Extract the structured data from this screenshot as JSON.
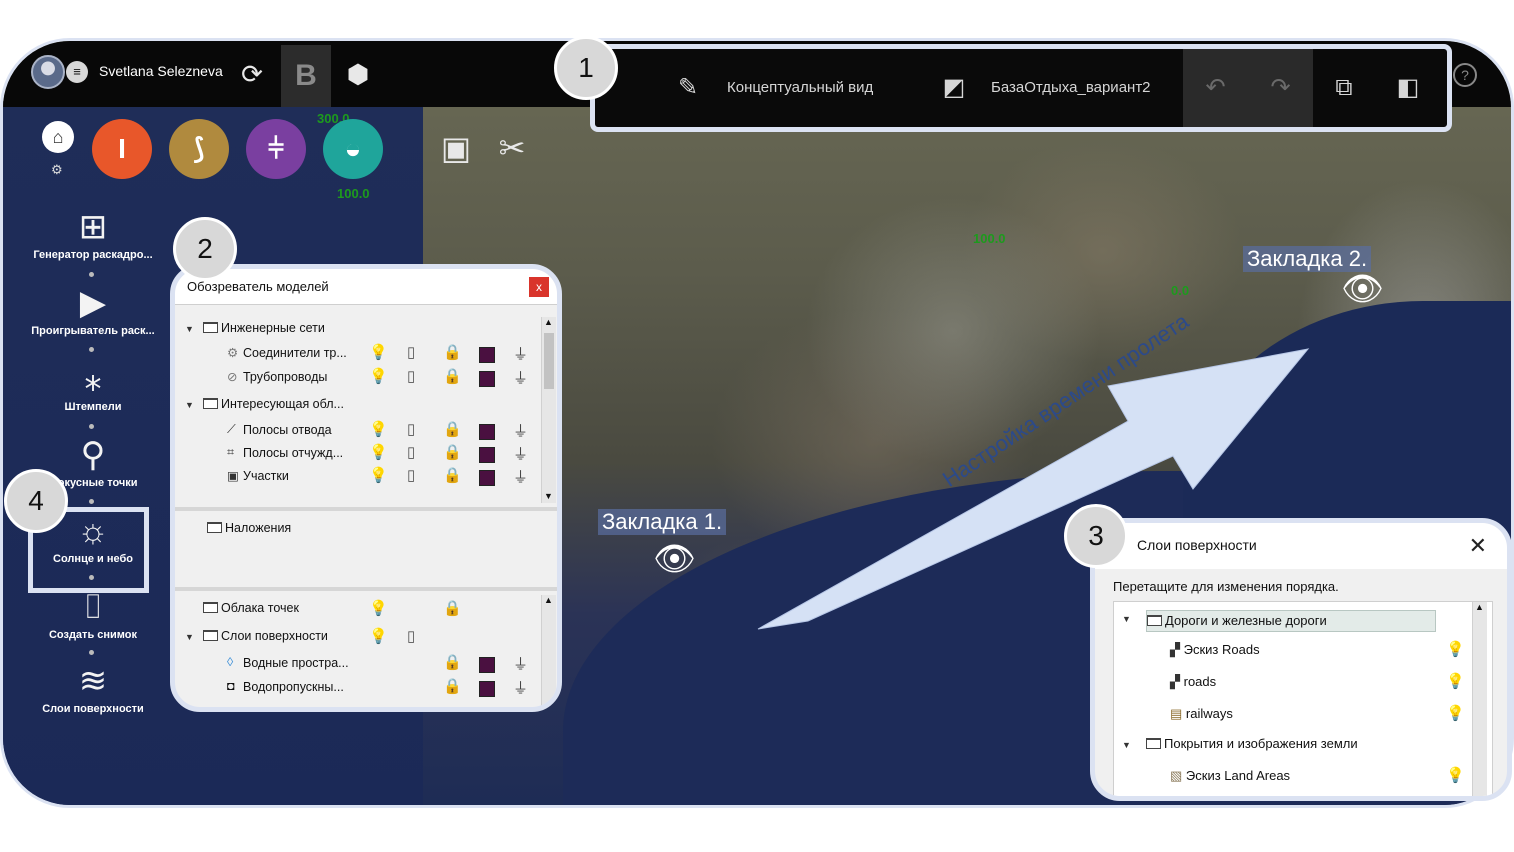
{
  "header": {
    "user_name": "Svetlana Selezneva",
    "menu_glyph": "≡",
    "sync_glyph": "⟳",
    "b_label": "B",
    "cube_glyph": "⬢",
    "help_glyph": "?"
  },
  "toolbar": {
    "view_mode": "Концептуальный вид",
    "proposal_name": "БазаОтдыха_вариант2",
    "pen_glyph": "✎",
    "proposal_glyph": "◩",
    "undo_glyph": "↶",
    "redo_glyph": "↷",
    "layout_glyph1": "⧉",
    "layout_glyph2": "◧"
  },
  "callouts": [
    "1",
    "2",
    "3",
    "4"
  ],
  "ribbon": {
    "home_glyph": "⌂",
    "gear_glyph": "⚙",
    "buttons": [
      {
        "name": "infrastructure",
        "glyph": "I",
        "color": "#e8572a"
      },
      {
        "name": "roads",
        "glyph": "⟆",
        "color": "#b08a3e"
      },
      {
        "name": "bridges",
        "glyph": "⫩",
        "color": "#7a3fa0"
      },
      {
        "name": "water",
        "glyph": "◒",
        "color": "#1fa59b"
      }
    ],
    "present_glyph": "▣",
    "tools_glyph": "✂"
  },
  "contours": [
    "300.0",
    "100.0",
    "100.0",
    "0.0"
  ],
  "side_tools": [
    {
      "name": "storyboard-generator",
      "glyph": "⊞",
      "label": "Генератор раскадро..."
    },
    {
      "name": "storyboard-player",
      "glyph": "▶",
      "label": "Проигрыватель раск..."
    },
    {
      "name": "stamps",
      "glyph": "⁎",
      "label": "Штемпели"
    },
    {
      "name": "focus-points",
      "glyph": "⚲",
      "label": "Фокусные точки"
    },
    {
      "name": "sun-and-sky",
      "glyph": "☼",
      "label": "Солнце и небо"
    },
    {
      "name": "snapshot",
      "glyph": "⌷",
      "label": "Создать снимок"
    },
    {
      "name": "surface-layers",
      "glyph": "≋",
      "label": "Слои поверхности"
    }
  ],
  "model_explorer": {
    "title": "Обозреватель моделей",
    "close_glyph": "x",
    "rows_top": [
      {
        "label": "Инженерные сети",
        "level": 0,
        "expanded": true,
        "icons": false
      },
      {
        "label": "Соединители тр...",
        "level": 1,
        "icons": true,
        "glyph": "⚙"
      },
      {
        "label": "Трубопроводы",
        "level": 1,
        "icons": true,
        "glyph": "⊘"
      },
      {
        "label": "Интересующая обл...",
        "level": 0,
        "expanded": true,
        "icons": false
      },
      {
        "label": "Полосы отвода",
        "level": 1,
        "icons": true,
        "glyph": "⟋"
      },
      {
        "label": "Полосы отчужд...",
        "level": 1,
        "icons": true,
        "glyph": "⌗"
      },
      {
        "label": "Участки",
        "level": 1,
        "icons": true,
        "glyph": "▣"
      }
    ],
    "overlay_label": "Наложения",
    "rows_bottom": [
      {
        "label": "Облака точек",
        "level": 0,
        "expanded": false
      },
      {
        "label": "Слои поверхности",
        "level": 0,
        "expanded": true
      },
      {
        "label": "Водные простра...",
        "level": 1,
        "glyph": "◊"
      },
      {
        "label": "Водопропускны...",
        "level": 1,
        "glyph": "◘"
      }
    ]
  },
  "bookmarks": {
    "bookmark1": "Закладка 1.",
    "bookmark2": "Закладка 2.",
    "eye_glyph": "👁",
    "flight_label": "Настройка времени пролета"
  },
  "surface_layers": {
    "title": "Слои поверхности",
    "close_glyph": "✕",
    "hint": "Перетащите для изменения порядка.",
    "groups": [
      {
        "label": "Дороги и железные дороги",
        "items": [
          "Эскиз Roads",
          "roads",
          "railways"
        ]
      },
      {
        "label": "Покрытия и изображения земли",
        "items": [
          "Эскиз Land Areas"
        ]
      }
    ]
  },
  "icons": {
    "bulb": "💡",
    "book": "▯",
    "lock": "🔒",
    "funnel": "⏚",
    "caret_down": "▼",
    "scroll_up": "▲",
    "scroll_down": "▼"
  }
}
